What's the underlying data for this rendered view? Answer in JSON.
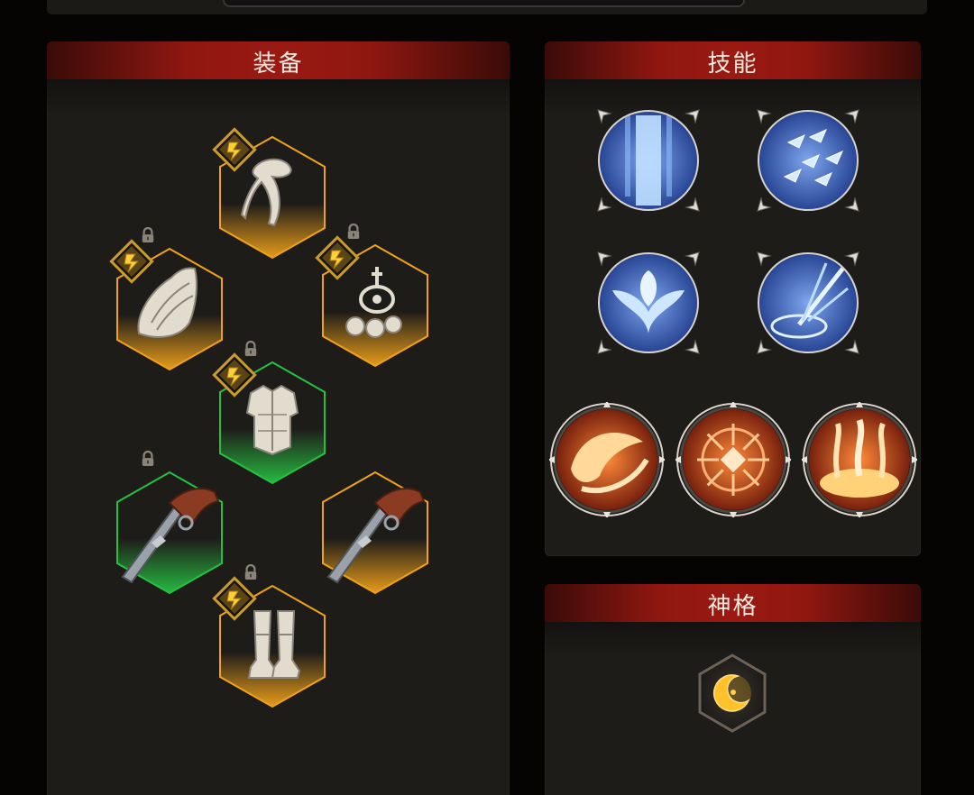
{
  "panels": {
    "equipment": {
      "title": "装备"
    },
    "skills": {
      "title": "技能"
    },
    "divinity": {
      "title": "神格"
    }
  },
  "equipment_slots": [
    {
      "name": "headgear-scarf",
      "rarity": "legendary",
      "rarity_color": "#f0a21a",
      "has_badge": true,
      "locked": false,
      "icon": "scarf-icon"
    },
    {
      "name": "shoulder-armor",
      "rarity": "legendary",
      "rarity_color": "#f0a21a",
      "has_badge": true,
      "locked": true,
      "icon": "pauldron-icon"
    },
    {
      "name": "amulet",
      "rarity": "legendary",
      "rarity_color": "#f0a21a",
      "has_badge": true,
      "locked": true,
      "icon": "amulet-icon"
    },
    {
      "name": "body-armor",
      "rarity": "uncommon",
      "rarity_color": "#27c142",
      "has_badge": true,
      "locked": true,
      "icon": "chestplate-icon"
    },
    {
      "name": "weapon-left",
      "rarity": "uncommon",
      "rarity_color": "#27c142",
      "has_badge": false,
      "locked": true,
      "icon": "flintlock-pistol-icon"
    },
    {
      "name": "weapon-right",
      "rarity": "legendary",
      "rarity_color": "#f0a21a",
      "has_badge": false,
      "locked": false,
      "icon": "flintlock-pistol-icon"
    },
    {
      "name": "boots",
      "rarity": "legendary",
      "rarity_color": "#f0a21a",
      "has_badge": true,
      "locked": true,
      "icon": "greaves-icon"
    }
  ],
  "skills": [
    {
      "name": "ice-pillar",
      "element": "frost",
      "icon": "ice-pillar-icon"
    },
    {
      "name": "ice-shards",
      "element": "frost",
      "icon": "ice-shards-icon"
    },
    {
      "name": "frost-bloom",
      "element": "frost",
      "icon": "frost-bloom-icon"
    },
    {
      "name": "frost-strike",
      "element": "frost",
      "icon": "frost-strike-icon"
    },
    {
      "name": "fire-wave",
      "element": "fire",
      "icon": "fire-wave-icon"
    },
    {
      "name": "fire-sigil",
      "element": "fire",
      "icon": "fire-sigil-icon"
    },
    {
      "name": "fire-pillars",
      "element": "fire",
      "icon": "fire-pillars-icon"
    }
  ],
  "divinity": {
    "icon": "crescent-moon-icon"
  },
  "colors": {
    "frost": "#3b62c9",
    "fire": "#c83a14",
    "legendary": "#f0a21a",
    "uncommon": "#27c142",
    "header": "#9a1a12"
  }
}
